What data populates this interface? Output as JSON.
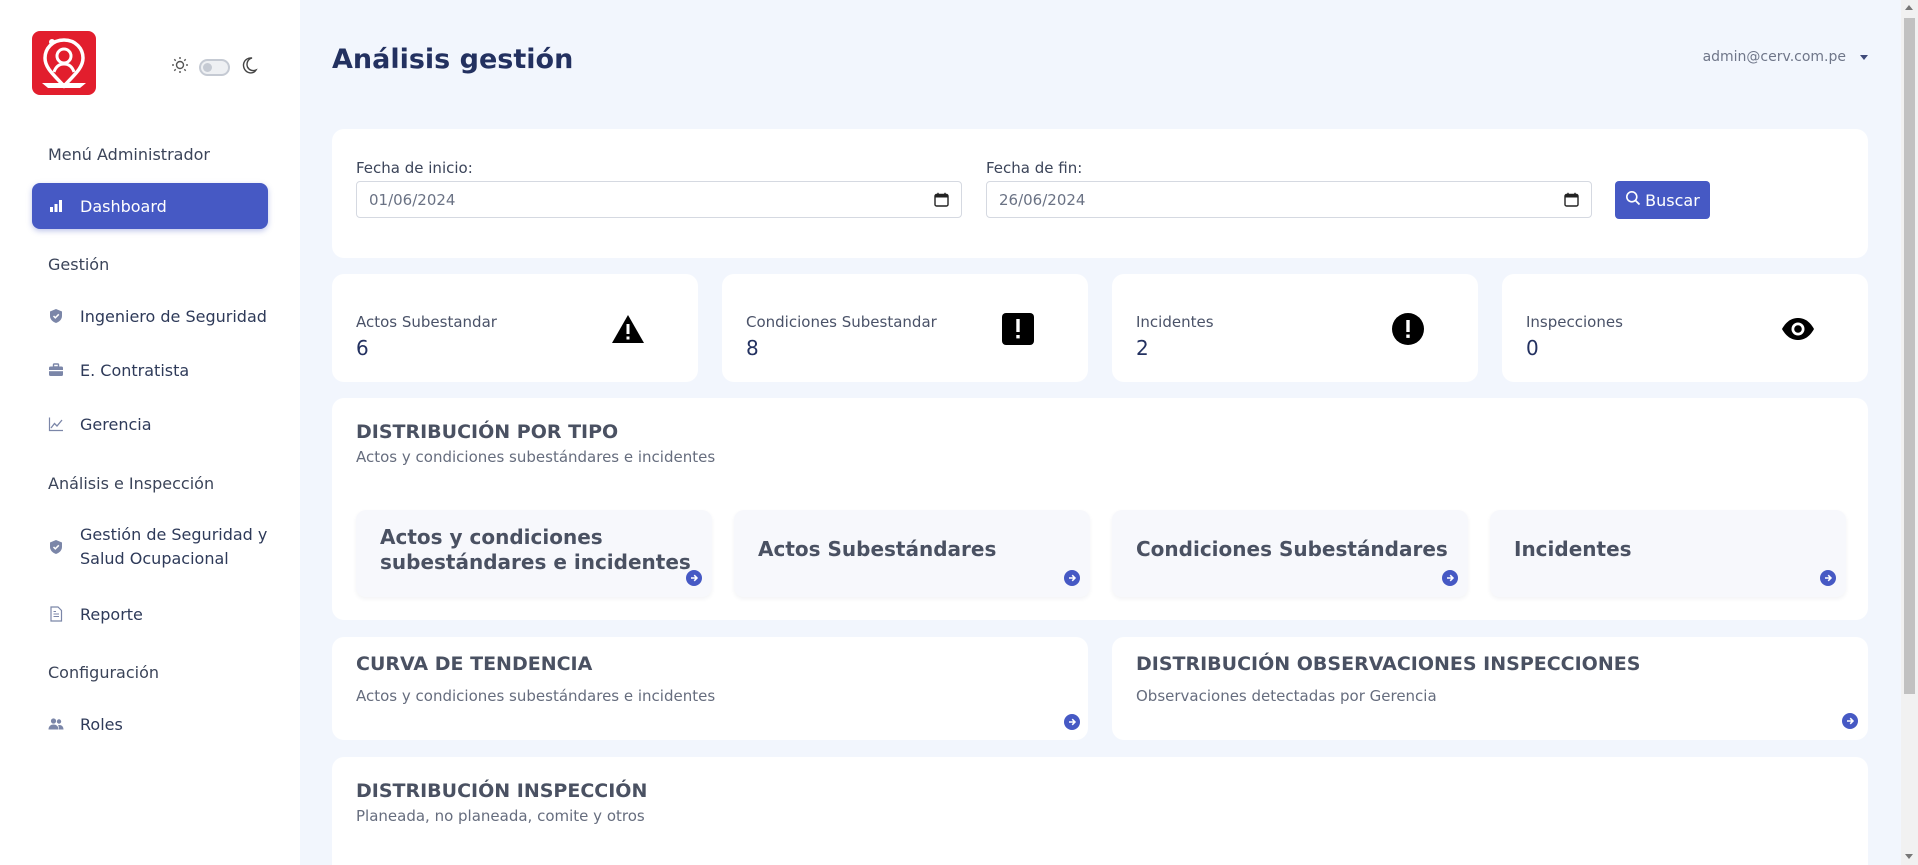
{
  "sidebar": {
    "menu_admin": "Menú Administrador",
    "dashboard": "Dashboard",
    "section_gestion": "Gestión",
    "ingeniero": "Ingeniero de Seguridad",
    "contratista": "E. Contratista",
    "gerencia": "Gerencia",
    "section_analisis": "Análisis e Inspección",
    "gestion_sso_line1": "Gestión de Seguridad y",
    "gestion_sso_line2": "Salud Ocupacional",
    "reporte": "Reporte",
    "section_config": "Configuración",
    "roles": "Roles"
  },
  "header": {
    "title": "Análisis gestión",
    "user_email": "admin@cerv.com.pe"
  },
  "filters": {
    "start_label": "Fecha de inicio:",
    "start_value": "01/06/2024",
    "end_label": "Fecha de fin:",
    "end_value": "26/06/2024",
    "search_label": "Buscar"
  },
  "stats": [
    {
      "label": "Actos Subestandar",
      "value": "6",
      "icon": "warning-triangle-icon"
    },
    {
      "label": "Condiciones Subestandar",
      "value": "8",
      "icon": "exclamation-square-icon"
    },
    {
      "label": "Incidentes",
      "value": "2",
      "icon": "exclamation-circle-icon"
    },
    {
      "label": "Inspecciones",
      "value": "0",
      "icon": "eye-icon"
    }
  ],
  "distribucion_tipo": {
    "title": "DISTRIBUCIÓN POR TIPO",
    "subtitle": "Actos y condiciones subestándares e incidentes",
    "cards": [
      {
        "line1": "Actos y condiciones",
        "line2": "subestándares e incidentes"
      },
      {
        "line1": "Actos Subestándares"
      },
      {
        "line1": "Condiciones Subestándares"
      },
      {
        "line1": "Incidentes"
      }
    ]
  },
  "curva": {
    "title": "CURVA DE TENDENCIA",
    "subtitle": "Actos y condiciones subestándares e incidentes"
  },
  "observaciones": {
    "title": "DISTRIBUCIÓN OBSERVACIONES INSPECCIONES",
    "subtitle": "Observaciones detectadas por Gerencia"
  },
  "inspeccion": {
    "title": "DISTRIBUCIÓN INSPECCIÓN",
    "subtitle": "Planeada, no planeada, comite y otros"
  },
  "colors": {
    "accent": "#4659c4",
    "brand_red": "#e21e2d",
    "page_bg": "#f2f6fd",
    "heading": "#233160"
  }
}
